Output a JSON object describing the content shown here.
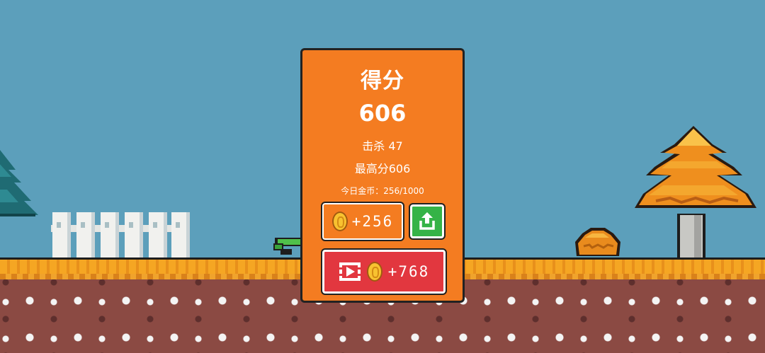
{
  "result_panel": {
    "title": "得分",
    "score": "606",
    "kills": "击杀 47",
    "best": "最高分606",
    "daily_coins": "今日金币：256/1000",
    "claim_label": "+256",
    "video_reward_label": "+768"
  },
  "colors": {
    "sky": "#5c9fbb",
    "panel": "#f47c21",
    "share_button": "#35b347",
    "video_button": "#e2373f",
    "ground_top": "#f5a623",
    "dirt": "#8b4a43"
  },
  "icons": {
    "coin": "coin-icon",
    "share": "share-icon",
    "video": "film-icon"
  }
}
